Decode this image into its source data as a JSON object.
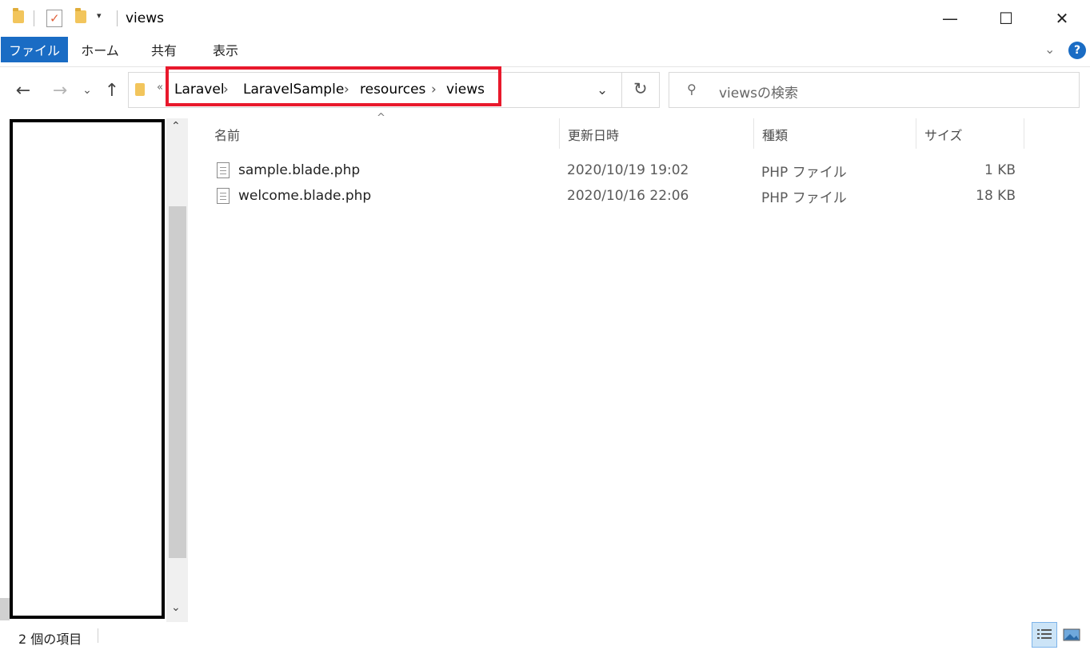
{
  "window": {
    "title": "views",
    "controls": {
      "minimize": "—",
      "maximize": "☐",
      "close": "✕"
    }
  },
  "ribbon": {
    "tabs": [
      "ファイル",
      "ホーム",
      "共有",
      "表示"
    ],
    "help": "?"
  },
  "address_bar": {
    "overflow": "«",
    "breadcrumbs": [
      "Laravel",
      "LaravelSample",
      "resources",
      "views"
    ]
  },
  "search": {
    "placeholder": "viewsの検索"
  },
  "columns": {
    "name": "名前",
    "modified": "更新日時",
    "type": "種類",
    "size": "サイズ"
  },
  "files": [
    {
      "name": "sample.blade.php",
      "modified": "2020/10/19 19:02",
      "type": "PHP ファイル",
      "size": "1 KB"
    },
    {
      "name": "welcome.blade.php",
      "modified": "2020/10/16 22:06",
      "type": "PHP ファイル",
      "size": "18 KB"
    }
  ],
  "status": {
    "item_count": "2 個の項目"
  },
  "colors": {
    "accent": "#1a6cc4",
    "highlight_box": "#e8192c"
  }
}
